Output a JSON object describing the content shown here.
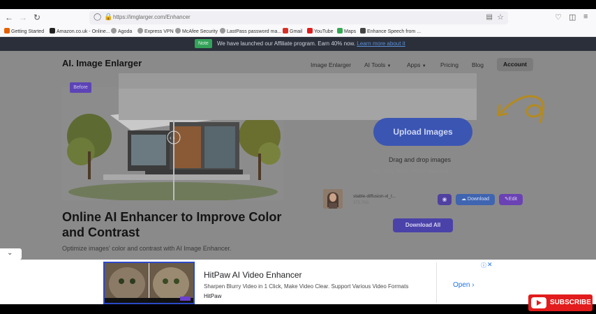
{
  "browser": {
    "url": "https://imglarger.com/Enhancer",
    "bookmarks": [
      "Getting Started",
      "Amazon.co.uk - Online...",
      "Agoda",
      "Express VPN",
      "McAfee Security",
      "LastPass password ma...",
      "Gmail",
      "YouTube",
      "Maps",
      "Enhance Speech from ..."
    ]
  },
  "note_bar": {
    "badge": "Note",
    "text": "We have launched our Affiliate program. Earn 40% now.",
    "link": "Learn more about it"
  },
  "header": {
    "logo": "AI. Image Enlarger",
    "nav": [
      "Image Enlarger",
      "AI Tools",
      "Apps",
      "Pricing",
      "Blog"
    ],
    "account": "Account"
  },
  "hero": {
    "before_tag": "Before",
    "headline": "Online AI Enhancer to Improve Color and Contrast",
    "subline": "Optimize images' color and contrast with AI Image Enhancer."
  },
  "uploader": {
    "upload_label": "Upload Images",
    "drag_text": "Drag and drop images",
    "formats_text": "PNG, JPG, JPEG, WEBP, Max 5MB",
    "file_name": "stable-diffusion-xl_l...",
    "file_size": "375.7Kb",
    "download_label": "Download",
    "edit_label": "Edit",
    "download_all_label": "Download All"
  },
  "ad": {
    "title": "HitPaw AI Video Enhancer",
    "description": "Sharpen Blurry Video in 1 Click, Make Video Clear. Support Various Video Formats",
    "brand": "HitPaw",
    "open_label": "Open"
  },
  "overlay": {
    "subscribe_label": "SUBSCRIBE"
  },
  "colors": {
    "upload_button": "#3b55b3",
    "download_all": "#4a42a8",
    "note_badge": "#35a25a",
    "subscribe_red": "#e21c1c"
  }
}
